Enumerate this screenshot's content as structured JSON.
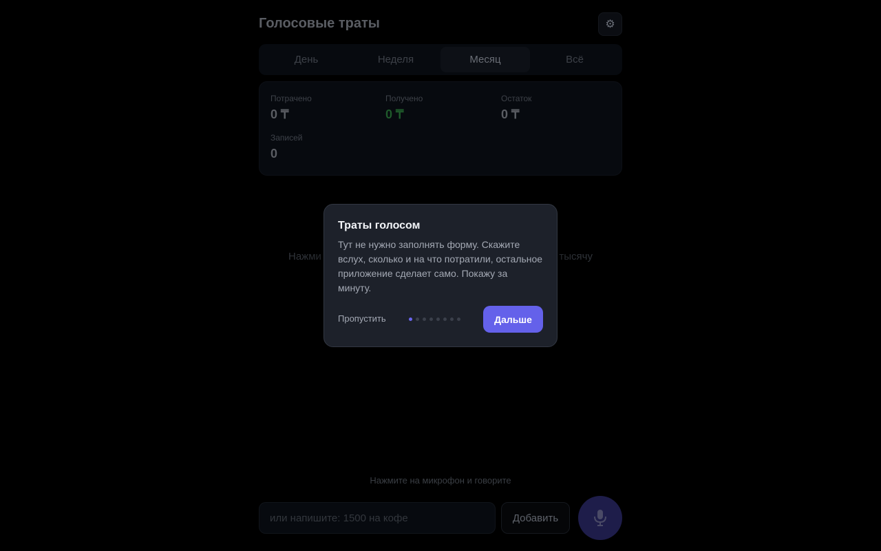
{
  "header": {
    "title": "Голосовые траты",
    "settings_icon": "gear-icon"
  },
  "tabs": [
    {
      "label": "День",
      "active": false
    },
    {
      "label": "Неделя",
      "active": false
    },
    {
      "label": "Месяц",
      "active": true
    },
    {
      "label": "Всё",
      "active": false
    }
  ],
  "stats": {
    "spent": {
      "label": "Потрачено",
      "value": "0 ₸"
    },
    "received": {
      "label": "Получено",
      "value": "0 ₸"
    },
    "balance": {
      "label": "Остаток",
      "value": "0 ₸"
    },
    "records": {
      "label": "Записей",
      "value": "0"
    }
  },
  "empty_hint": {
    "left": "Нажми",
    "right": "тысячу"
  },
  "voice_hint": "Нажмите на микрофон и говорите",
  "input": {
    "placeholder": "или напишите: 1500 на кофе",
    "value": ""
  },
  "add_button": "Добавить",
  "mic_icon": "microphone-icon",
  "modal": {
    "title": "Траты голосом",
    "text": "Тут не нужно заполнять форму. Скажите вслух, сколько и на что потратили, остальное приложение сделает само. Покажу за минуту.",
    "skip": "Пропустить",
    "next": "Дальше",
    "steps_total": 8,
    "current_step": 1
  },
  "colors": {
    "accent": "#6461ea",
    "modal_bg": "#1d212a",
    "received": "#1f5a2b"
  }
}
